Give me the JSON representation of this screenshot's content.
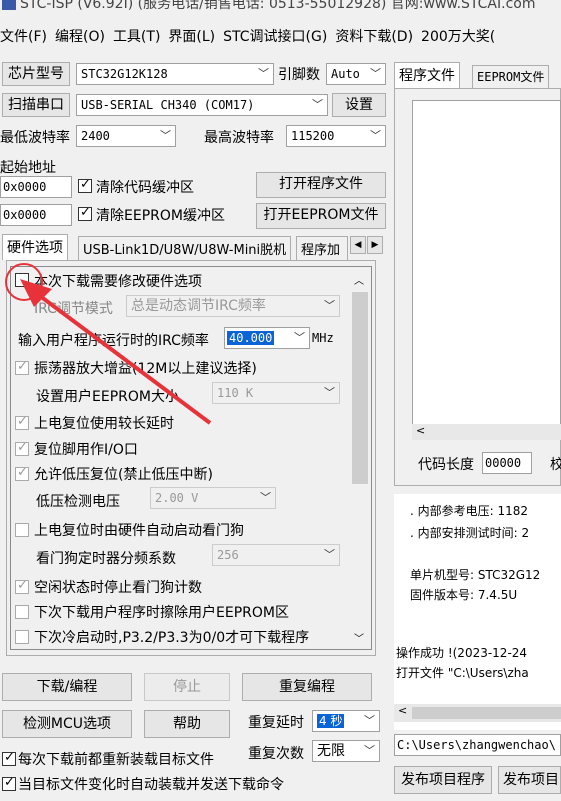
{
  "window": {
    "title": "STC-ISP (V6.92I) (服务电话/销售电话: 0513-55012928) 官网:www.STCAI.com"
  },
  "menu": [
    "文件(F)",
    "编程(O)",
    "工具(T)",
    "界面(L)",
    "STC调试接口(G)",
    "资料下载(D)",
    "200万大奖("
  ],
  "chip": {
    "label": "芯片型号",
    "value": "STC32G12K128",
    "pins_label": "引脚数",
    "pins_value": "Auto"
  },
  "port": {
    "scan_label": "扫描串口",
    "value": "USB-SERIAL CH340 (COM17)",
    "settings_label": "设置"
  },
  "baud": {
    "min_label": "最低波特率",
    "min_value": "2400",
    "max_label": "最高波特率",
    "max_value": "115200"
  },
  "address": {
    "label": "起始地址",
    "code_addr": "0x0000",
    "clear_code": "清除代码缓冲区",
    "open_prog": "打开程序文件",
    "eeprom_addr": "0x0000",
    "clear_eeprom": "清除EEPROM缓冲区",
    "open_eeprom": "打开EEPROM文件"
  },
  "left_tabs": [
    "硬件选项",
    "USB-Link1D/U8W/U8W-Mini脱机",
    "程序加"
  ],
  "hw": {
    "modify": "本次下载需要修改硬件选项",
    "irc_mode_label": "IRC调节模式",
    "irc_mode_value": "总是动态调节IRC频率",
    "irc_freq_label": "输入用户程序运行时的IRC频率",
    "irc_freq_value": "40.000",
    "irc_unit": "MHz",
    "osc_gain": "振荡器放大增益(12M以上建议选择)",
    "eeprom_size_label": "设置用户EEPROM大小",
    "eeprom_size_value": "110  K",
    "long_delay": "上电复位使用较长延时",
    "reset_io": "复位脚用作I/O口",
    "low_volt_reset": "允许低压复位(禁止低压中断)",
    "low_volt_label": "低压检测电压",
    "low_volt_value": "2.00 V",
    "watchdog_start": "上电复位时由硬件自动启动看门狗",
    "wdt_div_label": "看门狗定时器分频系数",
    "wdt_div_value": "256",
    "idle_stop_wdt": "空闲状态时停止看门狗计数",
    "erase_eeprom": "下次下载用户程序时擦除用户EEPROM区",
    "cold_boot": "下次冷启动时,P3.2/P3.3为0/0才可下载程序"
  },
  "actions": {
    "download": "下载/编程",
    "stop": "停止",
    "reprogram": "重复编程",
    "check_mcu": "检测MCU选项",
    "help": "帮助",
    "delay_label": "重复延时",
    "delay_value": "4 秒",
    "count_label": "重复次数",
    "count_value": "无限",
    "reload": "每次下载前都重新装载目标文件",
    "auto_load": "当目标文件变化时自动装载并发送下载命令"
  },
  "right_tabs": [
    "程序文件",
    "EEPROM文件"
  ],
  "right": {
    "code_len_label": "代码长度",
    "code_len_value": "00000",
    "code_len_tail": "校"
  },
  "log": [
    "内部参考电压: 1182",
    "内部安排测试时间: 2",
    "单片机型号: STC32G12",
    "固件版本号: 7.4.5U",
    "操作成功 !(2023-12-24",
    "打开文件 \"C:\\Users\\zha"
  ],
  "path": "C:\\Users\\zhangwenchao\\",
  "publish": [
    "发布项目程序",
    "发布项目"
  ],
  "colors": {
    "accent": "#0a64d6",
    "arrow": "#e8323a"
  }
}
